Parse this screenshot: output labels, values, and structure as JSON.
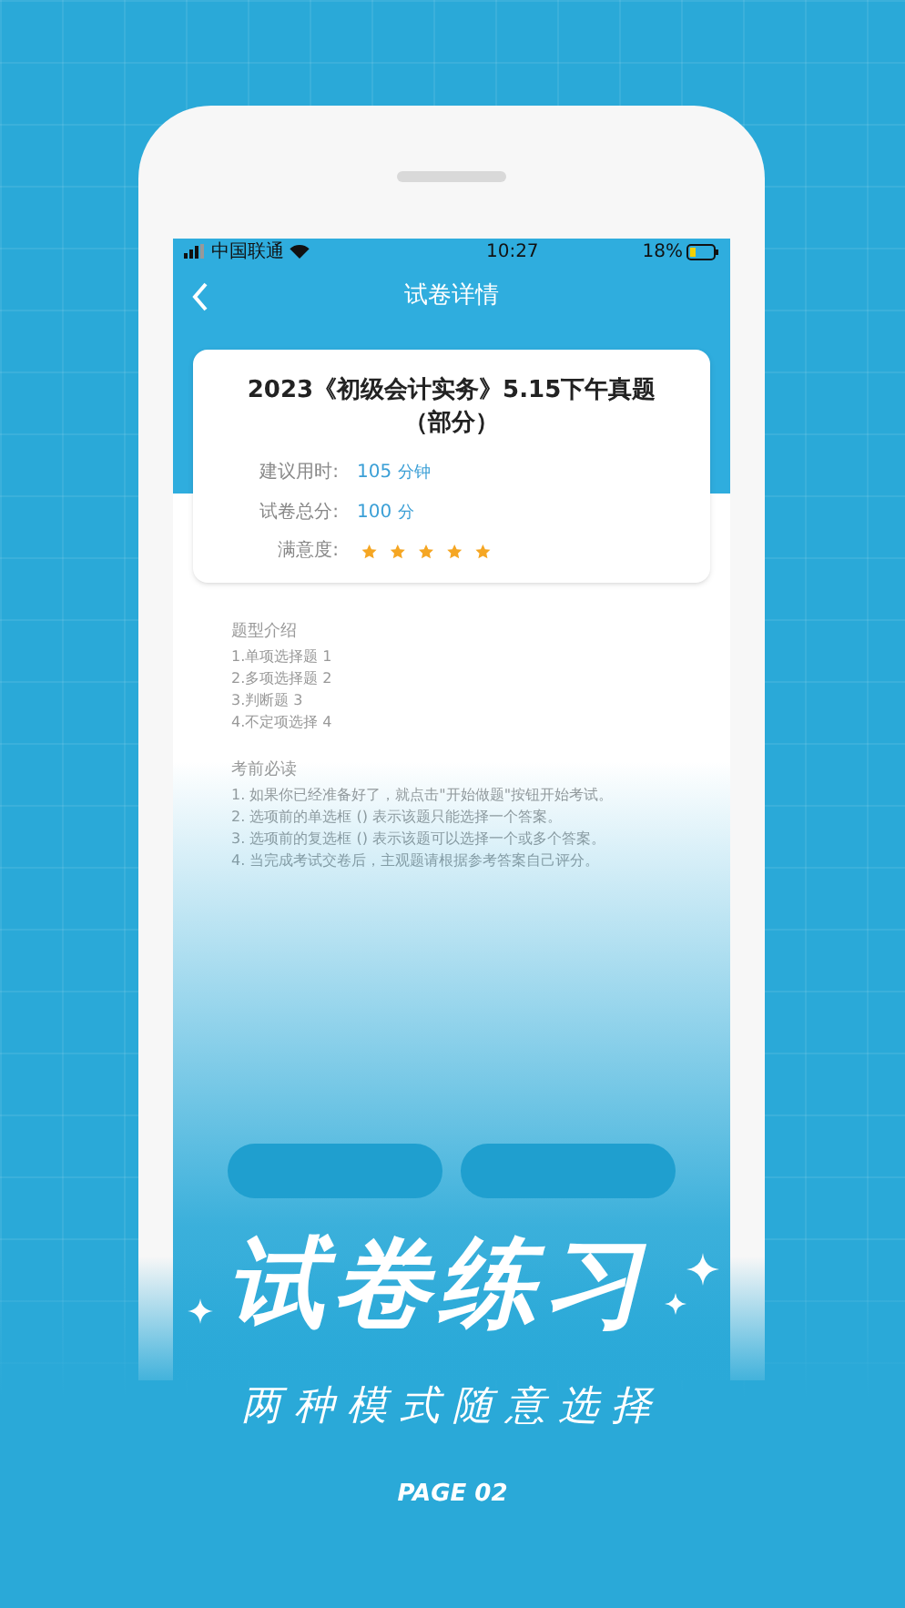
{
  "status_bar": {
    "carrier": "中国联通",
    "time": "10:27",
    "battery": "18%"
  },
  "nav_bar": {
    "title": "试卷详情"
  },
  "paper": {
    "title": "2023《初级会计实务》5.15下午真题（部分）",
    "info": [
      {
        "label": "建议用时:",
        "value": "105",
        "unit": "分钟"
      },
      {
        "label": "试卷总分:",
        "value": "100",
        "unit": "分"
      }
    ],
    "rating": {
      "label": "满意度:",
      "stars": 5
    }
  },
  "sections": [
    {
      "heading": "题型介绍",
      "lines": [
        "1.单项选择题 1",
        "2.多项选择题 2",
        "3.判断题 3",
        "4.不定项选择 4"
      ]
    },
    {
      "heading": "考前必读",
      "lines": [
        "1. 如果你已经准备好了，就点击\"开始做题\"按钮开始考试。",
        "2. 选项前的单选框 () 表示该题只能选择一个答案。",
        "3. 选项前的复选框 () 表示该题可以选择一个或多个答案。",
        "4. 当完成考试交卷后，主观题请根据参考答案自己评分。"
      ]
    }
  ],
  "headline": "试卷练习",
  "subtitle": "两种模式随意选择",
  "page_label": "PAGE 02"
}
